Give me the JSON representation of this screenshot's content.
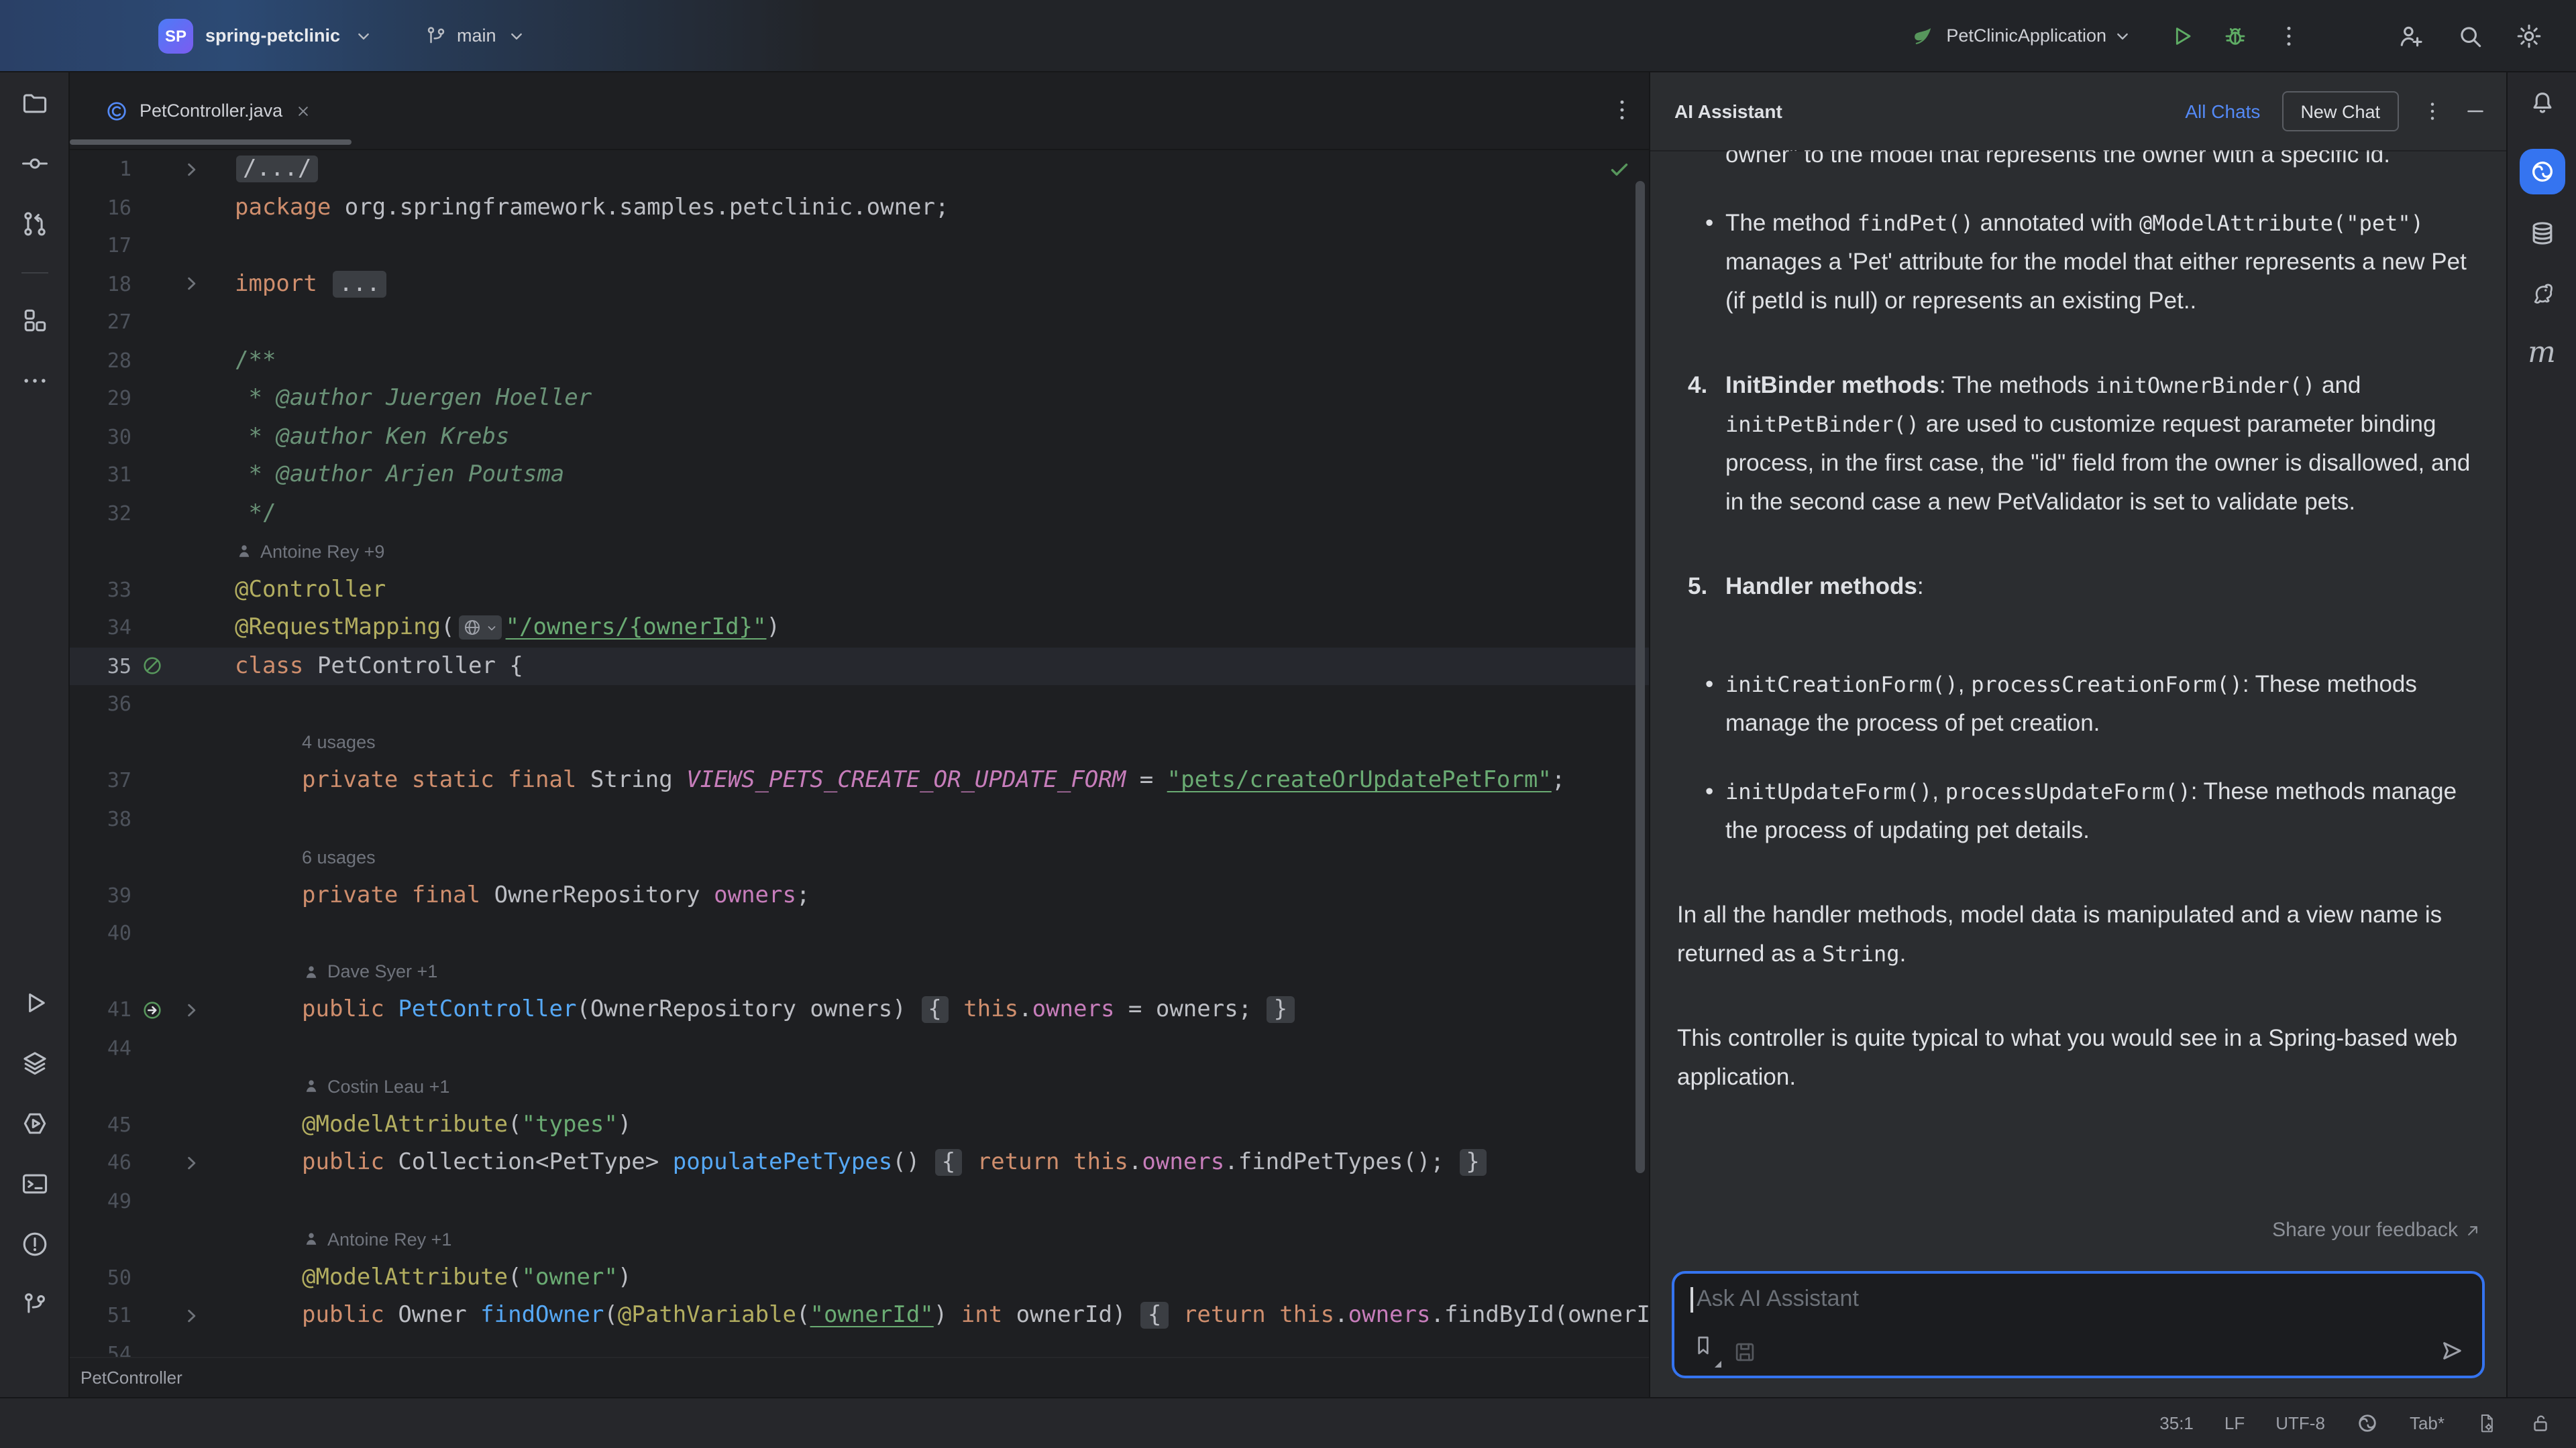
{
  "colors": {
    "accent_blue": "#3574f0",
    "link_blue": "#548af7",
    "run_green": "#5fad65",
    "spring_green": "#57965c",
    "editor_bg": "#1e1f22",
    "panel_bg": "#2b2d30",
    "keyword": "#cf8e6d",
    "string": "#6aab73",
    "annotation": "#b3ae60",
    "member": "#c77dbb",
    "method": "#56a8f5"
  },
  "titlebar": {
    "project_abbrev": "SP",
    "project": "spring-petclinic",
    "branch": "main",
    "run_config": "PetClinicApplication",
    "icons": [
      "spring-boot-icon",
      "chevron-down-icon",
      "run-icon",
      "debug-icon",
      "more-vertical-icon",
      "add-user-icon",
      "search-icon",
      "settings-icon"
    ]
  },
  "left_stripe": {
    "top": [
      "folder",
      "commit",
      "pull-requests",
      "divider",
      "structure",
      "more-horizontal"
    ],
    "bottom": [
      "run",
      "services",
      "endpoints",
      "terminal",
      "problems",
      "version-control"
    ]
  },
  "right_stripe": [
    "notifications-bell",
    "ai-assistant",
    "database",
    "gradle",
    "maven"
  ],
  "editor": {
    "tab": {
      "title": "PetController.java",
      "icon": "java-class"
    },
    "breadcrumb": "PetController",
    "lines": [
      {
        "t": "c",
        "n": "1",
        "g2": "fold",
        "segs": [
          [
            "chip",
            "/.../"
          ]
        ]
      },
      {
        "t": "c",
        "n": "16",
        "segs": [
          [
            "k",
            "package "
          ],
          [
            "p",
            "org.springframework.samples.petclinic.owner;"
          ]
        ]
      },
      {
        "t": "c",
        "n": "17",
        "segs": []
      },
      {
        "t": "c",
        "n": "18",
        "g2": "fold",
        "segs": [
          [
            "k",
            "import "
          ],
          [
            "chip",
            "..."
          ]
        ]
      },
      {
        "t": "c",
        "n": "27",
        "segs": []
      },
      {
        "t": "c",
        "n": "28",
        "segs": [
          [
            "c",
            "/**"
          ]
        ]
      },
      {
        "t": "c",
        "n": "29",
        "segs": [
          [
            "ci",
            " * @author Juergen Hoeller"
          ]
        ]
      },
      {
        "t": "c",
        "n": "30",
        "segs": [
          [
            "ci",
            " * @author Ken Krebs"
          ]
        ]
      },
      {
        "t": "c",
        "n": "31",
        "segs": [
          [
            "ci",
            " * @author Arjen Poutsma"
          ]
        ]
      },
      {
        "t": "c",
        "n": "32",
        "segs": [
          [
            "c",
            " */"
          ]
        ]
      },
      {
        "t": "i",
        "icon": "person",
        "text": "Antoine Rey +9",
        "ind": 0
      },
      {
        "t": "c",
        "n": "33",
        "segs": [
          [
            "a",
            "@Controller"
          ]
        ]
      },
      {
        "t": "c",
        "n": "34",
        "segs": [
          [
            "a",
            "@RequestMapping"
          ],
          [
            "p",
            "("
          ],
          [
            "globe",
            ""
          ],
          [
            "su",
            "\"/owners/{ownerId}\""
          ],
          [
            "p",
            ")"
          ]
        ]
      },
      {
        "t": "c",
        "n": "35",
        "hl": true,
        "g1": "bean",
        "segs": [
          [
            "k",
            "class "
          ],
          [
            "p",
            "PetController {"
          ]
        ]
      },
      {
        "t": "c",
        "n": "36",
        "segs": []
      },
      {
        "t": "i",
        "text": "4 usages",
        "ind": 1
      },
      {
        "t": "c",
        "n": "37",
        "ind": 1,
        "segs": [
          [
            "k",
            "private static final "
          ],
          [
            "p",
            "String "
          ],
          [
            "n",
            "VIEWS_PETS_CREATE_OR_UPDATE_FORM"
          ],
          [
            "p",
            " = "
          ],
          [
            "su",
            "\"pets/createOrUpdatePetForm\""
          ],
          [
            "p",
            ";"
          ]
        ]
      },
      {
        "t": "c",
        "n": "38",
        "segs": []
      },
      {
        "t": "i",
        "text": "6 usages",
        "ind": 1
      },
      {
        "t": "c",
        "n": "39",
        "ind": 1,
        "segs": [
          [
            "k",
            "private final "
          ],
          [
            "p",
            "OwnerRepository "
          ],
          [
            "f",
            "owners"
          ],
          [
            "p",
            ";"
          ]
        ]
      },
      {
        "t": "c",
        "n": "40",
        "segs": []
      },
      {
        "t": "i",
        "icon": "person",
        "text": "Dave Syer +1",
        "ind": 1
      },
      {
        "t": "c",
        "n": "41",
        "ind": 1,
        "g1": "leaf-arrow",
        "g2": "fold",
        "segs": [
          [
            "k",
            "public "
          ],
          [
            "m",
            "PetController"
          ],
          [
            "p",
            "(OwnerRepository owners) "
          ],
          [
            "chip",
            "{"
          ],
          [
            "p",
            " "
          ],
          [
            "k",
            "this"
          ],
          [
            "p",
            "."
          ],
          [
            "f",
            "owners"
          ],
          [
            "p",
            " = owners; "
          ],
          [
            "chip",
            "}"
          ]
        ]
      },
      {
        "t": "c",
        "n": "44",
        "segs": []
      },
      {
        "t": "i",
        "icon": "person",
        "text": "Costin Leau +1",
        "ind": 1
      },
      {
        "t": "c",
        "n": "45",
        "ind": 1,
        "segs": [
          [
            "a",
            "@ModelAttribute"
          ],
          [
            "p",
            "("
          ],
          [
            "s",
            "\"types\""
          ],
          [
            "p",
            ")"
          ]
        ]
      },
      {
        "t": "c",
        "n": "46",
        "ind": 1,
        "g2": "fold",
        "segs": [
          [
            "k",
            "public "
          ],
          [
            "p",
            "Collection<PetType> "
          ],
          [
            "m",
            "populatePetTypes"
          ],
          [
            "p",
            "() "
          ],
          [
            "chip",
            "{"
          ],
          [
            "p",
            " "
          ],
          [
            "k",
            "return "
          ],
          [
            "k",
            "this"
          ],
          [
            "p",
            "."
          ],
          [
            "f",
            "owners"
          ],
          [
            "p",
            ".findPetTypes(); "
          ],
          [
            "chip",
            "}"
          ]
        ]
      },
      {
        "t": "c",
        "n": "49",
        "segs": []
      },
      {
        "t": "i",
        "icon": "person",
        "text": "Antoine Rey +1",
        "ind": 1
      },
      {
        "t": "c",
        "n": "50",
        "ind": 1,
        "segs": [
          [
            "a",
            "@ModelAttribute"
          ],
          [
            "p",
            "("
          ],
          [
            "s",
            "\"owner\""
          ],
          [
            "p",
            ")"
          ]
        ]
      },
      {
        "t": "c",
        "n": "51",
        "ind": 1,
        "g2": "fold",
        "segs": [
          [
            "k",
            "public "
          ],
          [
            "p",
            "Owner "
          ],
          [
            "m",
            "findOwner"
          ],
          [
            "p",
            "("
          ],
          [
            "a",
            "@PathVariable"
          ],
          [
            "p",
            "("
          ],
          [
            "su",
            "\"ownerId\""
          ],
          [
            "p",
            ") "
          ],
          [
            "k",
            "int"
          ],
          [
            "p",
            " ownerId) "
          ],
          [
            "chip",
            "{"
          ],
          [
            "p",
            " "
          ],
          [
            "k",
            "return "
          ],
          [
            "k",
            "this"
          ],
          [
            "p",
            "."
          ],
          [
            "f",
            "owners"
          ],
          [
            "p",
            ".findById(ownerI"
          ]
        ]
      },
      {
        "t": "c",
        "n": "54",
        "segs": []
      }
    ]
  },
  "assistant": {
    "title": "AI Assistant",
    "all_chats_label": "All Chats",
    "new_chat_label": "New Chat",
    "blocks": [
      {
        "type": "cont",
        "runs": [
          [
            "t",
            "owner\" to the model that represents the owner with a specific id."
          ]
        ]
      },
      {
        "type": "bullet",
        "gap": "md",
        "runs": [
          [
            "t",
            "The method "
          ],
          [
            "code",
            "findPet()"
          ],
          [
            "t",
            " annotated with "
          ],
          [
            "code",
            "@ModelAttribute(\"pet\")"
          ],
          [
            "t",
            " manages a 'Pet' attribute for the model that either represents a new Pet (if petId is null) or represents an existing Pet.."
          ]
        ]
      },
      {
        "type": "numbered",
        "marker": "4.",
        "gap": "md",
        "runs": [
          [
            "b",
            "InitBinder methods"
          ],
          [
            "t",
            ": The methods "
          ],
          [
            "code",
            "initOwnerBinder()"
          ],
          [
            "t",
            " and "
          ],
          [
            "code",
            "initPetBinder()"
          ],
          [
            "t",
            " are used to customize request parameter binding process, in the first case, the \"id\" field from the owner is disallowed, and in the second case a new PetValidator is set to validate pets."
          ]
        ]
      },
      {
        "type": "numbered",
        "marker": "5.",
        "gap": "lg",
        "runs": [
          [
            "b",
            "Handler methods"
          ],
          [
            "t",
            ":"
          ]
        ]
      },
      {
        "type": "bullet",
        "runs": [
          [
            "code",
            "initCreationForm()"
          ],
          [
            "t",
            ", "
          ],
          [
            "code",
            "processCreationForm()"
          ],
          [
            "t",
            ": These methods manage the process of pet creation."
          ]
        ]
      },
      {
        "type": "bullet",
        "gap": "md",
        "runs": [
          [
            "code",
            "initUpdateForm()"
          ],
          [
            "t",
            ", "
          ],
          [
            "code",
            "processUpdateForm()"
          ],
          [
            "t",
            ": These methods manage the process of updating pet details."
          ]
        ]
      },
      {
        "type": "p",
        "gap": "md",
        "runs": [
          [
            "t",
            "In all the handler methods, model data is manipulated and a view name is returned as a "
          ],
          [
            "code",
            "String"
          ],
          [
            "t",
            "."
          ]
        ]
      },
      {
        "type": "p",
        "runs": [
          [
            "t",
            "This controller is quite typical to what you would see in a Spring-based web application."
          ]
        ]
      }
    ],
    "feedback_label": "Share your feedback",
    "input_placeholder": "Ask AI Assistant"
  },
  "status_bar": {
    "position": "35:1",
    "line_separator": "LF",
    "encoding": "UTF-8",
    "indent": "Tab*"
  }
}
